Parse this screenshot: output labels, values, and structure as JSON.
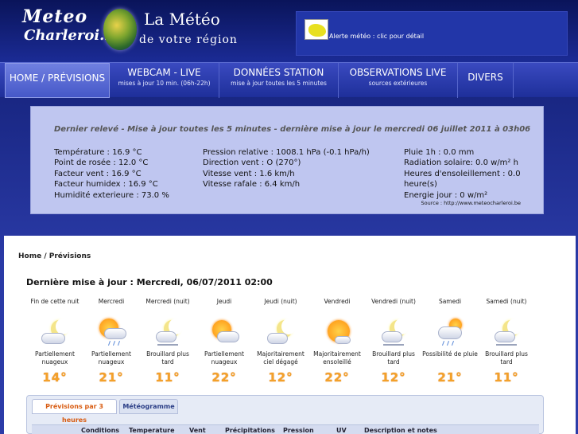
{
  "header": {
    "logo_line1": "Meteo",
    "logo_line2": "Charleroi.be",
    "tagline_line1": "La Météo",
    "tagline_line2": "de votre région",
    "alert_text": "Alerte météo : clic pour détail"
  },
  "nav": [
    {
      "label": "HOME / PRÉVISIONS",
      "sub": ""
    },
    {
      "label": "WEBCAM - LIVE",
      "sub": "mises à jour 10 min. (06h-22h)"
    },
    {
      "label": "DONNÉES STATION",
      "sub": "mise à jour toutes les 5 minutes"
    },
    {
      "label": "OBSERVATIONS LIVE",
      "sub": "sources extérieures"
    },
    {
      "label": "DIVERS",
      "sub": ""
    }
  ],
  "obs": {
    "title": "Dernier relevé - Mise à jour toutes les 5 minutes - dernière mise à jour le mercredi 06 juillet 2011 à 03h06",
    "col1": [
      "Température : 16.9 °C",
      "Point de rosée : 12.0 °C",
      "Facteur vent : 16.9 °C",
      "Facteur humidex : 16.9 °C",
      "Humidité exterieure : 73.0 %"
    ],
    "col2": [
      "Pression relative : 1008.1 hPa (-0.1 hPa/h)",
      "Direction vent : O (270°)",
      "Vitesse vent : 1.6 km/h",
      "Vitesse rafale : 6.4 km/h"
    ],
    "col3": [
      "Pluie 1h : 0.0 mm",
      "Radiation solaire:  0.0 w/m² h",
      "Heures d'ensoleillement : 0.0 heure(s)",
      "Energie jour : 0 w/m²"
    ],
    "source": "Source : http://www.meteocharleroi.be"
  },
  "content": {
    "breadcrumb": "Home / Prévisions",
    "updated": "Dernière mise à jour : Mercredi, 06/07/2011 02:00"
  },
  "forecast": [
    {
      "name": "Fin de cette nuit",
      "cond": "Partiellement nuageux",
      "temp": "14°",
      "icon": "moon-cloud-icon"
    },
    {
      "name": "Mercredi",
      "cond": "Partiellement nuageux",
      "temp": "21°",
      "icon": "sun-cloud-rain-icon"
    },
    {
      "name": "Mercredi (nuit)",
      "cond": "Brouillard plus tard",
      "temp": "11°",
      "icon": "moon-fog-icon"
    },
    {
      "name": "Jeudi",
      "cond": "Partiellement nuageux",
      "temp": "22°",
      "icon": "sun-cloud-icon"
    },
    {
      "name": "Jeudi (nuit)",
      "cond": "Majoritairement ciel dégagé",
      "temp": "12°",
      "icon": "moon-cloud-icon"
    },
    {
      "name": "Vendredi",
      "cond": "Majoritairement ensoleillé",
      "temp": "22°",
      "icon": "sun-icon"
    },
    {
      "name": "Vendredi (nuit)",
      "cond": "Brouillard plus tard",
      "temp": "12°",
      "icon": "moon-fog-icon"
    },
    {
      "name": "Samedi",
      "cond": "Possibilité de pluie",
      "temp": "21°",
      "icon": "cloud-rain-icon"
    },
    {
      "name": "Samedi (nuit)",
      "cond": "Brouillard plus tard",
      "temp": "11°",
      "icon": "moon-fog-icon"
    }
  ],
  "tabs": [
    {
      "label": "Prévisions par 3 heures",
      "active": true
    },
    {
      "label": "Météogramme",
      "active": false
    }
  ],
  "table_headers": [
    "Conditions",
    "Temperature",
    "Vent",
    "Précipitations",
    "Pression",
    "UV",
    "Description et notes"
  ]
}
